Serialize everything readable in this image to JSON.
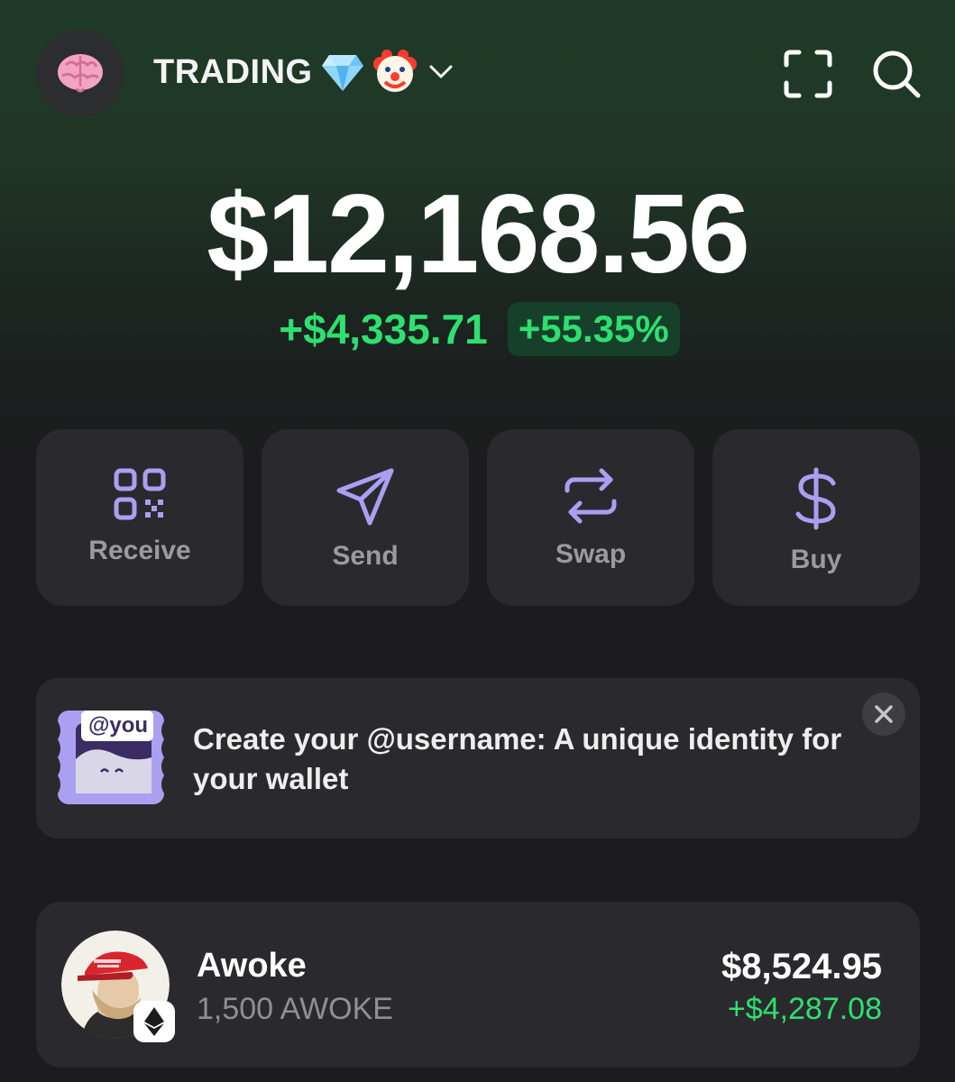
{
  "header": {
    "avatar_icon": "brain-icon",
    "wallet_name": "TRADING",
    "emoji_1": "gem-icon",
    "emoji_2": "clown-icon",
    "scan_icon": "scan-icon",
    "search_icon": "search-icon"
  },
  "portfolio": {
    "balance": "$12,168.56",
    "change_amount": "+$4,335.71",
    "change_percent": "+55.35%",
    "positive_color": "#2ee070"
  },
  "actions": [
    {
      "label": "Receive",
      "icon": "qr-code-icon"
    },
    {
      "label": "Send",
      "icon": "send-icon"
    },
    {
      "label": "Swap",
      "icon": "swap-icon"
    },
    {
      "label": "Buy",
      "icon": "dollar-icon"
    }
  ],
  "accent_color": "#ab9ff2",
  "promo": {
    "badge": "@you",
    "text": "Create your @username: A unique identity for your wallet"
  },
  "tokens": [
    {
      "name": "Awoke",
      "quantity": "1,500 AWOKE",
      "value": "$8,524.95",
      "change": "+$4,287.08",
      "chain_icon": "ethereum-icon"
    }
  ]
}
